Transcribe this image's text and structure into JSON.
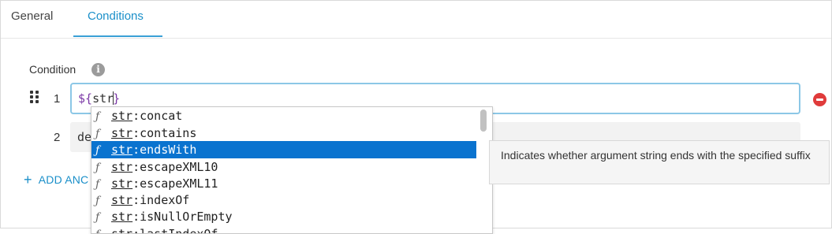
{
  "tabs": [
    {
      "label": "General",
      "active": false
    },
    {
      "label": "Conditions",
      "active": true
    }
  ],
  "section": {
    "label": "Condition",
    "info_icon": "info-icon"
  },
  "rows": [
    {
      "number": "1",
      "value_token": "${",
      "value_typed": "str",
      "value_close": "}"
    },
    {
      "number": "2",
      "value": "de"
    }
  ],
  "add_link": {
    "label": "ADD ANC",
    "icon": "plus-icon"
  },
  "autocomplete": {
    "items": [
      {
        "prefix": "str",
        "suffix": ":concat"
      },
      {
        "prefix": "str",
        "suffix": ":contains"
      },
      {
        "prefix": "str",
        "suffix": ":endsWith",
        "selected": true
      },
      {
        "prefix": "str",
        "suffix": ":escapeXML10"
      },
      {
        "prefix": "str",
        "suffix": ":escapeXML11"
      },
      {
        "prefix": "str",
        "suffix": ":indexOf"
      },
      {
        "prefix": "str",
        "suffix": ":isNullOrEmpty"
      },
      {
        "prefix": "str",
        "suffix": ":lastIndexOf"
      }
    ],
    "item_icon_glyph": "ƒ",
    "tooltip": "Indicates whether argument string ends with the specified suffix"
  },
  "colors": {
    "accent": "#1a8fc9",
    "selected": "#0a73cf",
    "remove": "#e03b3b",
    "token": "#7a37a6"
  }
}
